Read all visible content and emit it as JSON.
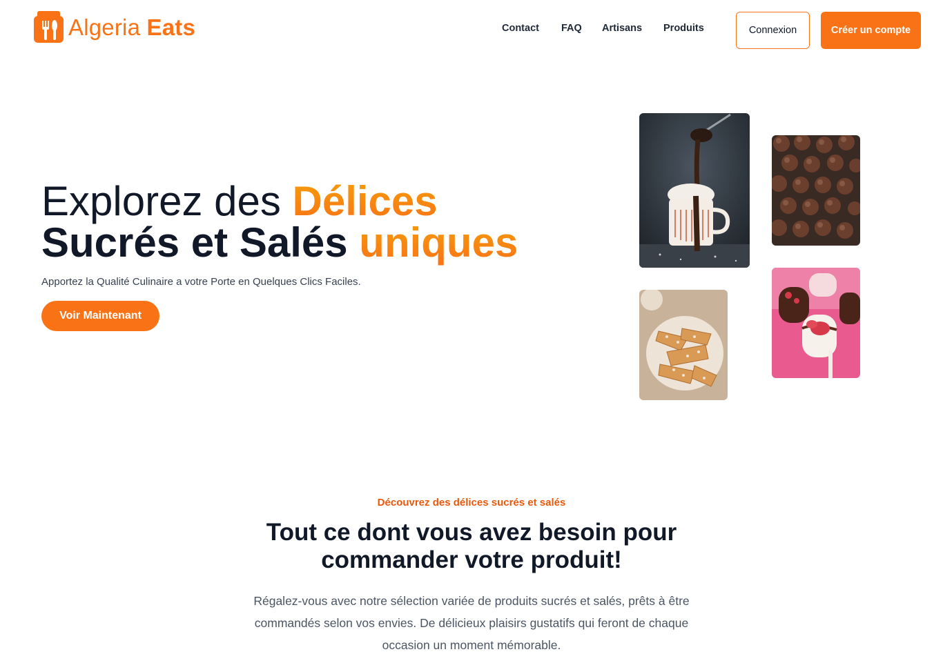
{
  "brand": {
    "name_light": "Algeria",
    "name_strong": "Eats",
    "accent_color": "#f97316",
    "logo_icon": "utensils-bag-icon"
  },
  "nav": {
    "links": [
      "Contact",
      "FAQ",
      "Artisans",
      "Produits"
    ],
    "login_label": "Connexion",
    "signup_label": "Créer un compte"
  },
  "hero": {
    "title_line1_plain": "Explorez des ",
    "title_line1_accent": "Délices",
    "title_line2_plain": "Sucrés et Salés ",
    "title_line2_accent": "uniques",
    "subtitle": "Apportez la Qualité Culinaire a votre Porte en Quelques Clics Faciles.",
    "cta_label": "Voir Maintenant",
    "images": [
      "hot-chocolate-photo",
      "chocolate-truffles-photo",
      "fried-pastry-photo",
      "strawberry-cake-pops-photo"
    ]
  },
  "section": {
    "eyebrow": "Découvrez des délices sucrés et salés",
    "title": "Tout ce dont vous avez besoin pour commander votre produit!",
    "description": "Régalez-vous avec notre sélection variée de produits sucrés et salés, prêts à être commandés selon vos envies. De délicieux plaisirs gustatifs qui feront de chaque occasion un moment mémorable."
  }
}
